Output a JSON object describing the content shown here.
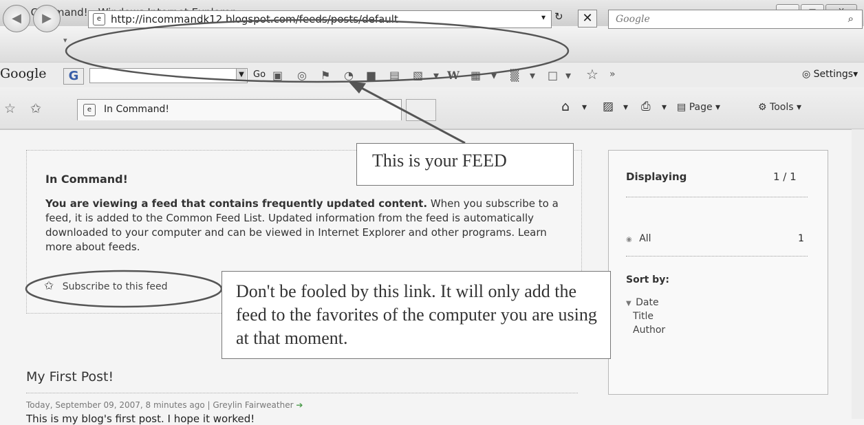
{
  "window": {
    "title": "In Command! - Windows Internet Explorer",
    "controls": [
      "–",
      "□",
      "X"
    ]
  },
  "nav": {
    "address": "http://incommandk12.blogspot.com/feeds/posts/default",
    "search_placeholder": "Google"
  },
  "google_toolbar": {
    "label": "Google",
    "g_button": "G",
    "go": "Go",
    "wikipedia": "W",
    "chevron": "»",
    "settings": "Settings"
  },
  "tab": {
    "title": "In Command!"
  },
  "command_bar": {
    "page": "Page",
    "tools": "Tools"
  },
  "feed": {
    "title": "In Command!",
    "desc_bold": "You are viewing a feed that contains frequently updated content.",
    "desc_rest": " When you subscribe to a feed, it is added to the Common Feed List. Updated information from the feed is automatically downloaded to your computer and can be viewed in Internet Explorer and other programs. ",
    "learn_more": "Learn more about feeds.",
    "subscribe": "Subscribe to this feed"
  },
  "sidebar": {
    "displaying": "Displaying",
    "count": "1 / 1",
    "all": "All",
    "all_count": "1",
    "sort_by": "Sort by:",
    "sort_options": [
      "Date",
      "Title",
      "Author"
    ]
  },
  "post": {
    "title": "My First Post!",
    "meta": "Today, September 09, 2007, 8 minutes ago | Greylin Fairweather",
    "body": "This is my blog's first post. I hope it worked!"
  },
  "callouts": {
    "feed": "This is your FEED",
    "fool": "Don't be fooled by this link. It will only add the feed to the favorites of the computer you are using at that moment."
  }
}
